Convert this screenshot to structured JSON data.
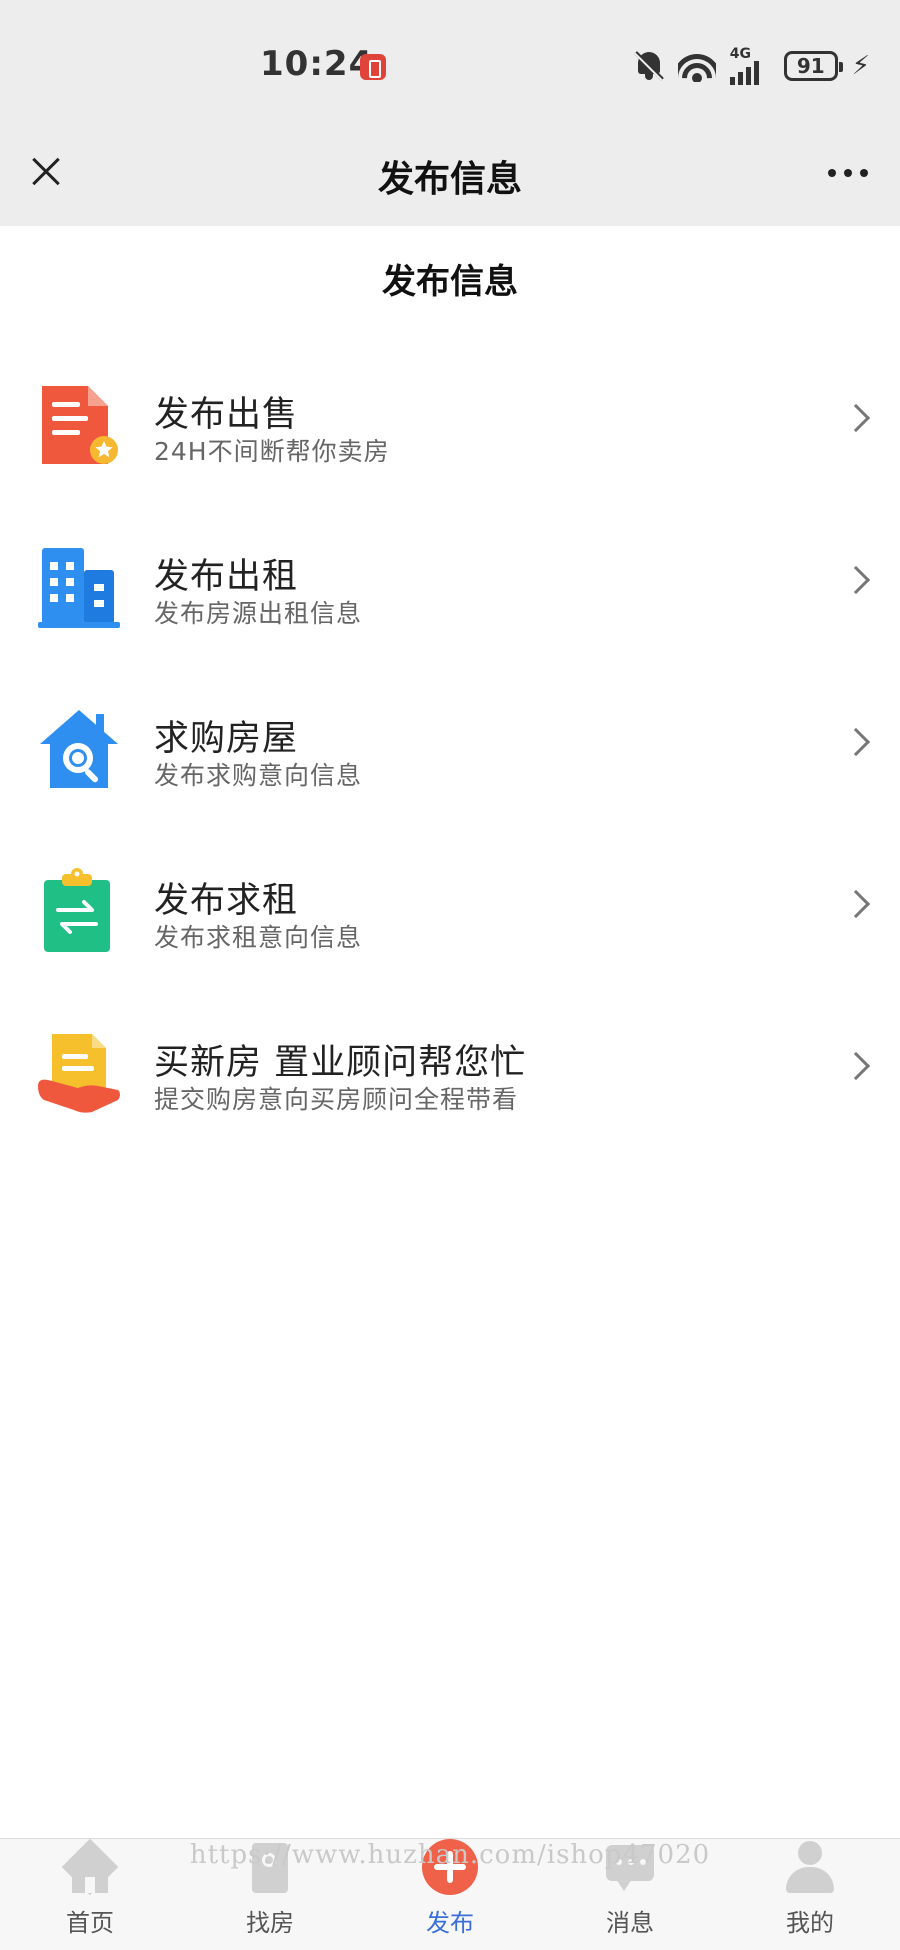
{
  "status_bar": {
    "time": "10:24",
    "network": "4G",
    "battery": "91"
  },
  "nav": {
    "title": "发布信息",
    "close_icon": "close-icon",
    "more_icon": "more-icon"
  },
  "page": {
    "title": "发布信息"
  },
  "menu": {
    "items": [
      {
        "title": "发布出售",
        "subtitle": "24H不间断帮你卖房",
        "icon": "sell-document-icon",
        "color": "#f0583e"
      },
      {
        "title": "发布出租",
        "subtitle": "发布房源出租信息",
        "icon": "building-icon",
        "color": "#2f8ff0"
      },
      {
        "title": "求购房屋",
        "subtitle": "发布求购意向信息",
        "icon": "house-search-icon",
        "color": "#2f8ff0"
      },
      {
        "title": "发布求租",
        "subtitle": "发布求租意向信息",
        "icon": "clipboard-exchange-icon",
        "color": "#1fbf86"
      },
      {
        "title": "买新房 置业顾问帮您忙",
        "subtitle": "提交购房意向买房顾问全程带看",
        "icon": "document-hand-icon",
        "color": "#f5c02b"
      }
    ]
  },
  "watermark": "https://www.huzhan.com/ishop47020",
  "tab_bar": {
    "active_color": "#3a6fd8",
    "tabs": [
      {
        "label": "首页",
        "icon": "home-icon"
      },
      {
        "label": "找房",
        "icon": "find-house-icon"
      },
      {
        "label": "发布",
        "icon": "plus-circle-icon",
        "active": true
      },
      {
        "label": "消息",
        "icon": "message-icon"
      },
      {
        "label": "我的",
        "icon": "profile-icon"
      }
    ]
  }
}
